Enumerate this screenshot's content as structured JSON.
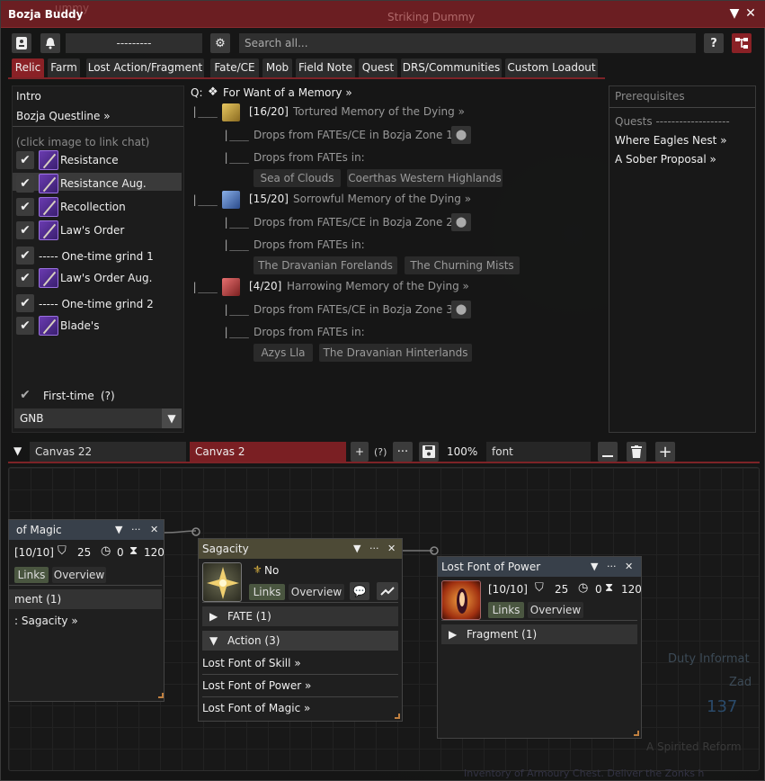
{
  "window": {
    "title": "Bozja Buddy",
    "ghost_title": "Striking Dummy",
    "ghost_left": "ummy"
  },
  "toolbar": {
    "dropdown_value": "---------",
    "search_placeholder": "Search all...",
    "help_label": "?"
  },
  "tabs": [
    "Relic",
    "Farm",
    "Lost Action/Fragment",
    "Fate/CE",
    "Mob",
    "Field Note",
    "Quest",
    "DRS/Communities",
    "Custom Loadout"
  ],
  "sidebar": {
    "intro": "Intro",
    "questline": "Bozja Questline",
    "questline_arrow": "»",
    "hint": "(click image to link chat)",
    "items": [
      {
        "label": "Resistance",
        "icon": "relic-weapon-icon"
      },
      {
        "label": "Resistance Aug.",
        "icon": "relic-weapon-icon"
      },
      {
        "label": "Recollection",
        "icon": "relic-weapon-icon"
      },
      {
        "label": "Law's Order",
        "icon": "relic-weapon-icon"
      },
      {
        "label": "----- One-time grind 1",
        "icon": ""
      },
      {
        "label": "Law's Order Aug.",
        "icon": "relic-weapon-icon"
      },
      {
        "label": "----- One-time grind 2",
        "icon": ""
      },
      {
        "label": "Blade's",
        "icon": "relic-weapon-icon"
      }
    ],
    "first_time": "First-time",
    "first_time_help": "(?)",
    "job": "GNB"
  },
  "quest": {
    "prefix": "Q:",
    "title": "For Want of a Memory",
    "arrow": "»",
    "tree": "|___",
    "memories": [
      {
        "count": "[16/20]",
        "name": "Tortured Memory of the Dying",
        "color": "#c8a23a",
        "drops": "Drops from FATEs/CE in Bozja Zone 1",
        "fates_label": "Drops from FATEs in:",
        "zones": [
          "Sea of Clouds",
          "Coerthas Western Highlands"
        ]
      },
      {
        "count": "[15/20]",
        "name": "Sorrowful Memory of the Dying",
        "color": "#4a7ac0",
        "drops": "Drops from FATEs/CE in Bozja Zone 2",
        "fates_label": "Drops from FATEs in:",
        "zones": [
          "The Dravanian Forelands",
          "The Churning Mists"
        ]
      },
      {
        "count": "[4/20]",
        "name": "Harrowing Memory of the Dying",
        "color": "#b84040",
        "drops": "Drops from FATEs/CE in Bozja Zone 3",
        "fates_label": "Drops from FATEs in:",
        "zones": [
          "Azys Lla",
          "The Dravanian Hinterlands"
        ]
      }
    ]
  },
  "prereq": {
    "title": "Prerequisites",
    "quests_label": "Quests -------------------",
    "quests": [
      "Where Eagles Nest",
      "A Sober Proposal"
    ],
    "arrow": "»"
  },
  "canvas_bar": {
    "canvas_select": "Canvas 22",
    "canvas_name": "Canvas 2",
    "plus": "+",
    "help": "(?)",
    "dots": "···",
    "zoom": "100%",
    "font": "font"
  },
  "nodes": {
    "magic": {
      "title": "of Magic",
      "progress": "[10/10]",
      "cost": "25",
      "cd": "0",
      "dur": "120",
      "tab_links": "Links",
      "tab_overview": "Overview",
      "row": "ment (1)",
      "link": ": Sagacity",
      "arrow": "»"
    },
    "sagacity": {
      "title": "Sagacity",
      "no": "No",
      "tab_links": "Links",
      "tab_overview": "Overview",
      "fate_row": "FATE (1)",
      "action_row": "Action (3)",
      "links": [
        "Lost Font of Skill",
        "Lost Font of Power",
        "Lost Font of Magic"
      ],
      "arrow": "»"
    },
    "power": {
      "title": "Lost Font of Power",
      "progress": "[10/10]",
      "cost": "25",
      "cd": "0",
      "dur": "120",
      "tab_links": "Links",
      "tab_overview": "Overview",
      "fragment_row": "Fragment (1)"
    }
  },
  "background_text": {
    "duty": "Duty Informat",
    "zad": "Zad",
    "num": "137",
    "spirited": "A Spirited Reform",
    "bottom": "Inventory of Armoury Chest. Deliver the Zonks h"
  },
  "colors": {
    "accent": "#8a2126",
    "title_bar": "#6b1e22",
    "node_blue": "#38404a",
    "node_olive": "#4d4a36"
  }
}
